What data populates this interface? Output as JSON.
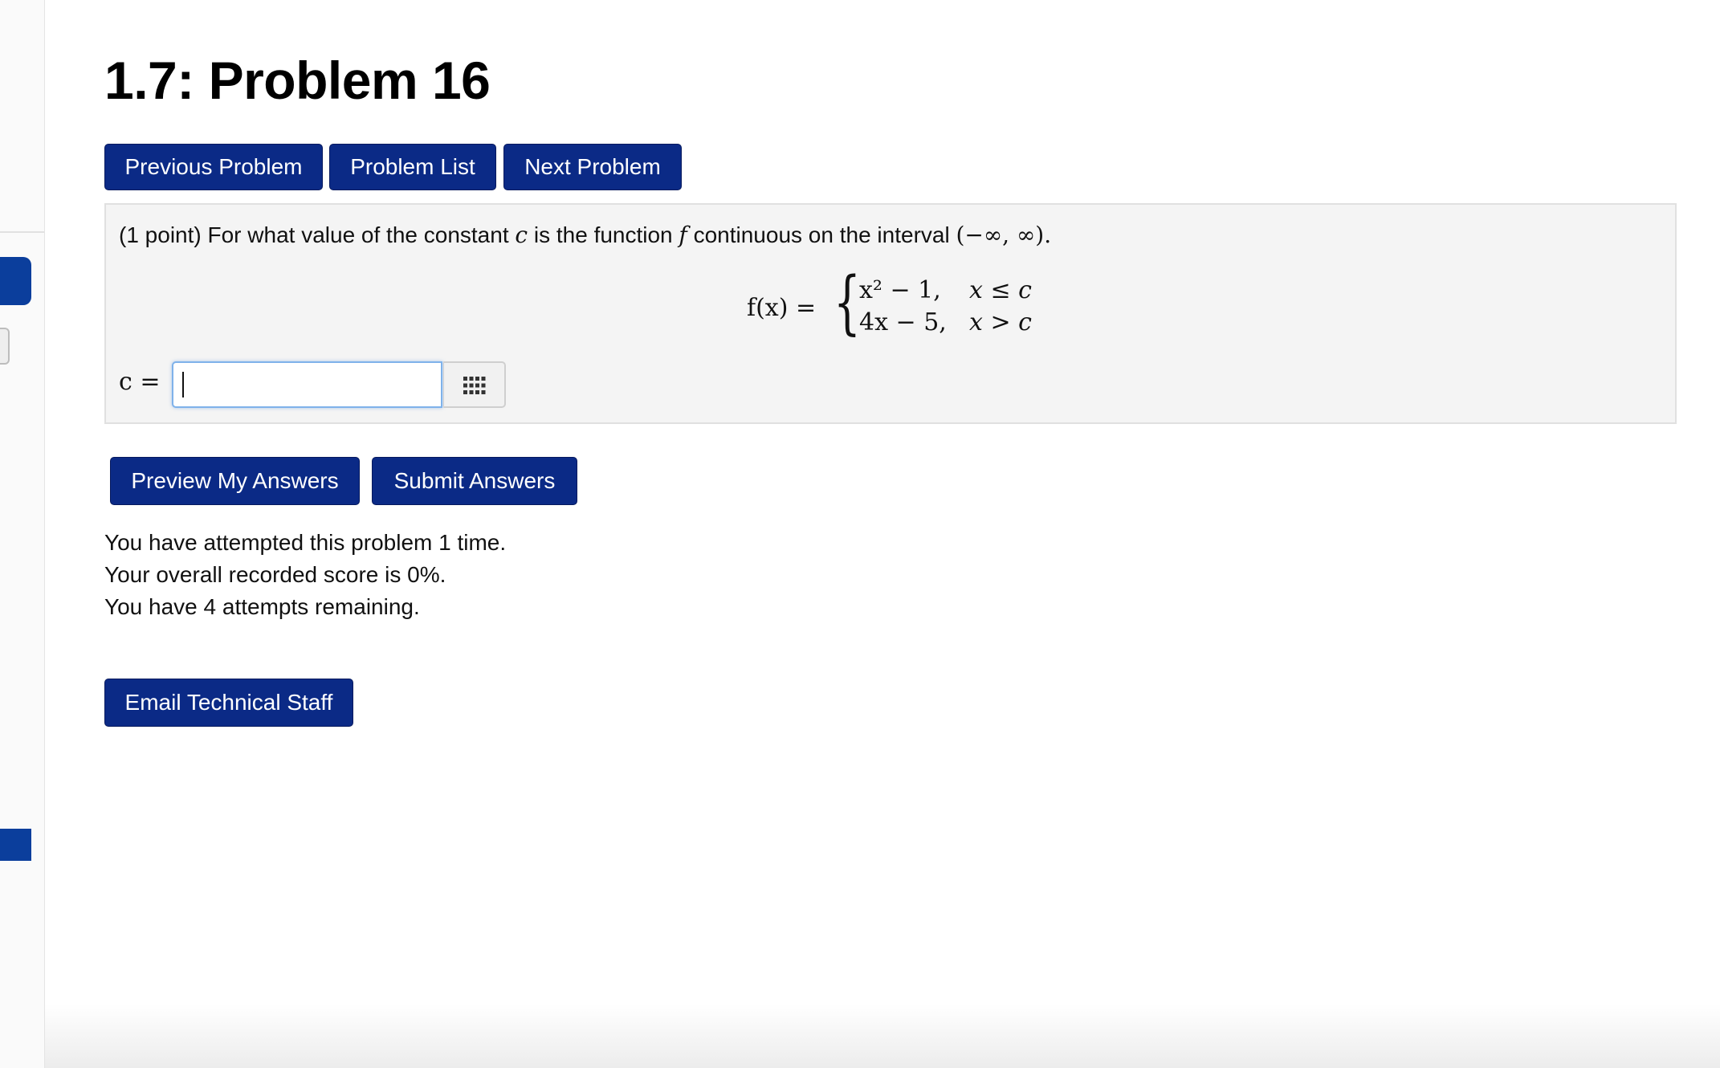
{
  "page": {
    "title": "1.7: Problem 16"
  },
  "nav": {
    "previous_label": "Previous Problem",
    "list_label": "Problem List",
    "next_label": "Next Problem"
  },
  "problem": {
    "points": "(1 point)",
    "text_before_c": "For what value of the constant",
    "var_c": "c",
    "text_before_f": "is the function",
    "var_f": "f",
    "text_before_interval": "continuous on the interval",
    "interval": "(−∞, ∞).",
    "formula": {
      "lhs": "f(x) =",
      "case1_expr": "x² − 1,",
      "case1_cond": "x ≤ c",
      "case2_expr": "4x − 5,",
      "case2_cond": "x > c"
    }
  },
  "answer": {
    "label": "c =",
    "value": ""
  },
  "actions": {
    "preview_label": "Preview My Answers",
    "submit_label": "Submit Answers"
  },
  "status": {
    "attempts": "You have attempted this problem 1 time.",
    "score": "Your overall recorded score is 0%.",
    "remaining": "You have 4 attempts remaining."
  },
  "footer": {
    "email_label": "Email Technical Staff"
  },
  "icons": {
    "keypad": "keypad-grid-icon"
  },
  "colors": {
    "button_bg": "#0b2a86",
    "sidebar_accent": "#0b3e9c",
    "input_focus": "#7fb2ea",
    "problem_bg": "#f4f4f4"
  }
}
